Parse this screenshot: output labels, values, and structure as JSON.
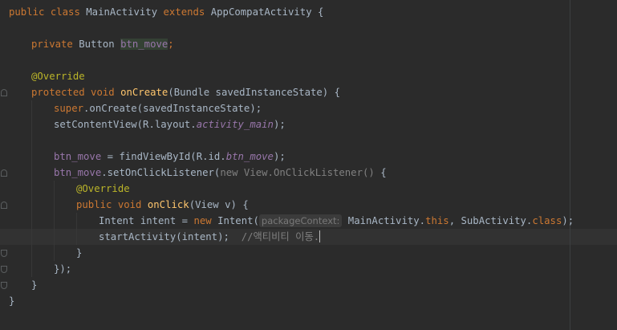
{
  "editor": {
    "lines": {
      "l1": {
        "t1": "public",
        "t2": " ",
        "t3": "class",
        "t4": " MainActivity ",
        "t5": "extends",
        "t6": " AppCompatActivity {"
      },
      "l2": {
        "t1": "private",
        "t2": " Button ",
        "t3": "btn_move",
        "t4": ";"
      },
      "l3": {
        "t1": "@Override"
      },
      "l4": {
        "t1": "protected",
        "t2": " ",
        "t3": "void",
        "t4": " ",
        "t5": "onCreate",
        "t6": "(Bundle savedInstanceState) {"
      },
      "l5": {
        "t1": "super",
        "t2": ".onCreate(savedInstanceState);"
      },
      "l6": {
        "t1": "setContentView(R.layout.",
        "t2": "activity_main",
        "t3": ");"
      },
      "l7": {
        "t1": "btn_move",
        "t2": " = findViewById(R.id.",
        "t3": "btn_move",
        "t4": ");"
      },
      "l8": {
        "t1": "btn_move",
        "t2": ".setOnClickListener(",
        "t3": "new View.OnClickListener()",
        "t4": " {"
      },
      "l9": {
        "t1": "@Override"
      },
      "l10": {
        "t1": "public",
        "t2": " ",
        "t3": "void",
        "t4": " ",
        "t5": "onClick",
        "t6": "(View v) {"
      },
      "l11": {
        "t1": "Intent intent = ",
        "t2": "new",
        "t3": " Intent(",
        "hint": "packageContext:",
        "t4": " MainActivity.",
        "t5": "this",
        "t6": ", SubActivity.",
        "t7": "class",
        "t8": ");"
      },
      "l12": {
        "t1": "startActivity(intent);  ",
        "t2": "//액티비티 이동."
      },
      "l13": {
        "t1": "}"
      },
      "l14": {
        "t1": "});"
      },
      "l15": {
        "t1": "}"
      },
      "l16": {
        "t1": "}"
      }
    }
  }
}
